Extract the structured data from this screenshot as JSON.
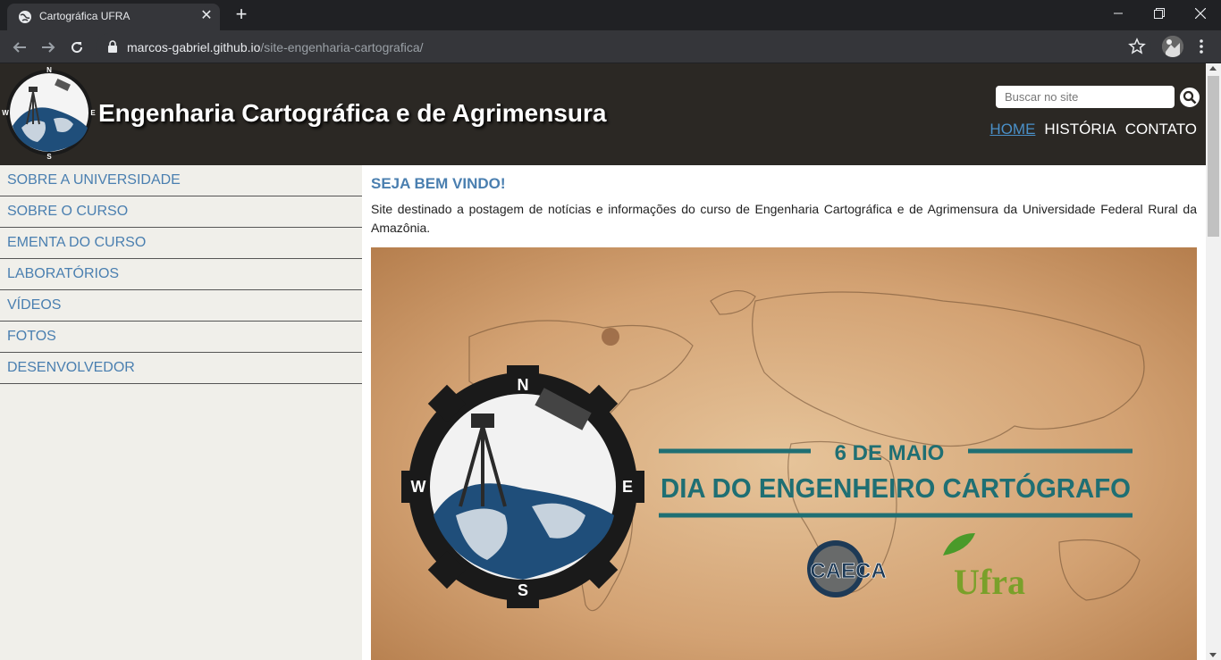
{
  "browser": {
    "tab_title": "Cartográfica UFRA",
    "url_host": "marcos-gabriel.github.io",
    "url_path": "/site-engenharia-cartografica/"
  },
  "header": {
    "title": "Engenharia Cartográfica e de Agrimensura",
    "search_placeholder": "Buscar no site",
    "nav": [
      "HOME",
      "HISTÓRIA",
      "CONTATO"
    ],
    "logo_letters": [
      "N",
      "S",
      "W",
      "E"
    ]
  },
  "sidebar": {
    "items": [
      "SOBRE A UNIVERSIDADE",
      "SOBRE O CURSO",
      "EMENTA DO CURSO",
      "LABORATÓRIOS",
      "VÍDEOS",
      "FOTOS",
      "DESENVOLVEDOR"
    ]
  },
  "main": {
    "heading": "SEJA BEM VINDO!",
    "intro": "Site destinado a postagem de notícias e informações do curso de Engenharia Cartográfica e de Agrimensura da Universidade Federal Rural da Amazônia."
  },
  "banner": {
    "date": "6 DE MAIO",
    "headline": "DIA DO ENGENHEIRO CARTÓGRAFO",
    "logo1": "CAECA",
    "logo2": "Ufra",
    "compass_letters": [
      "N",
      "S",
      "W",
      "E"
    ]
  },
  "colors": {
    "header_bg": "#2b2824",
    "link_blue": "#4a7fb0",
    "sidebar_bg": "#f0efea",
    "banner_teal": "#1f6f73"
  }
}
